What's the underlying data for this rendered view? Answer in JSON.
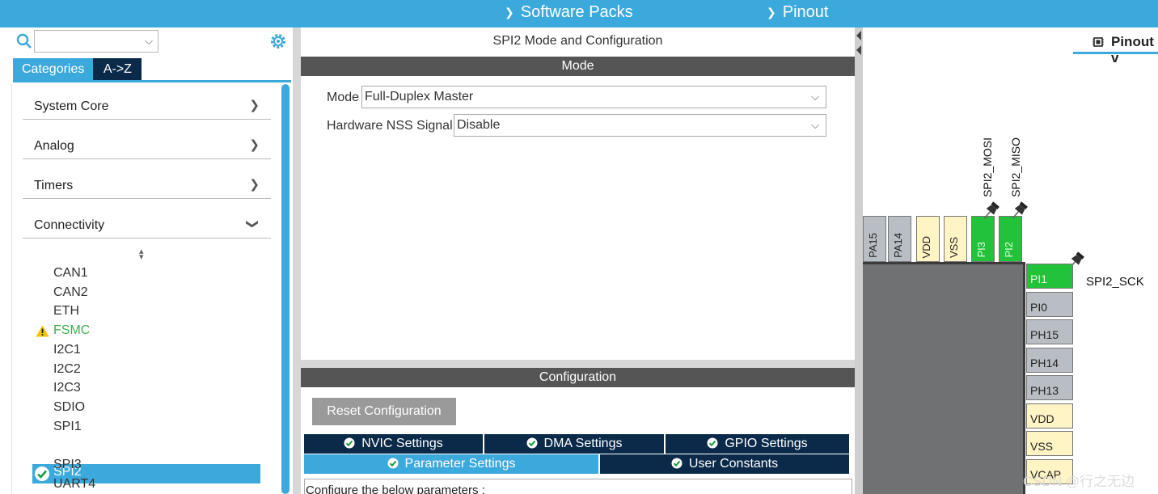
{
  "topbar": {
    "menu1": "Software Packs",
    "menu2": "Pinout",
    "color": "#3ca9dc"
  },
  "left": {
    "search_value": "",
    "tabs": [
      "Categories",
      "A->Z"
    ],
    "categories": [
      "System Core",
      "Analog",
      "Timers",
      "Connectivity"
    ],
    "peripherals": [
      "CAN1",
      "CAN2",
      "ETH",
      "FSMC",
      "I2C1",
      "I2C2",
      "I2C3",
      "SDIO",
      "SPI1",
      "SPI2",
      "SPI3",
      "UART4"
    ],
    "selected": "SPI2",
    "warning_item": "FSMC"
  },
  "middle": {
    "title": "SPI2 Mode and Configuration",
    "mode_header": "Mode",
    "mode_label": "Mode",
    "mode_value": "Full-Duplex Master",
    "nss_label": "Hardware NSS Signal",
    "nss_value": "Disable",
    "config_header": "Configuration",
    "reset_button": "Reset Configuration",
    "tabs": [
      "NVIC Settings",
      "DMA Settings",
      "GPIO Settings",
      "Parameter Settings",
      "User Constants"
    ],
    "active_tab": "Parameter Settings",
    "params_text": "Configure the below parameters :"
  },
  "right": {
    "tab_label": "Pinout v",
    "top_pins": [
      "PA15",
      "PA14",
      "VDD",
      "VSS",
      "PI3",
      "PI2"
    ],
    "side_pins": [
      "PI1",
      "PI0",
      "PH15",
      "PH14",
      "PH13",
      "VDD",
      "VSS",
      "VCAP"
    ],
    "signals": {
      "pi3": "SPI2_MOSI",
      "pi2": "SPI2_MISO",
      "pi1": "SPI2_SCK"
    },
    "watermark": "CSDN @行之无边"
  },
  "colors": {
    "accent": "#3ca9dc",
    "dark_tab": "#0b2a4a",
    "header_gray": "#555555",
    "pin_green": "#22c23a",
    "pin_yellow": "#fff4c4",
    "pin_gray": "#b9bec4",
    "warning_green": "#3ab34a"
  }
}
